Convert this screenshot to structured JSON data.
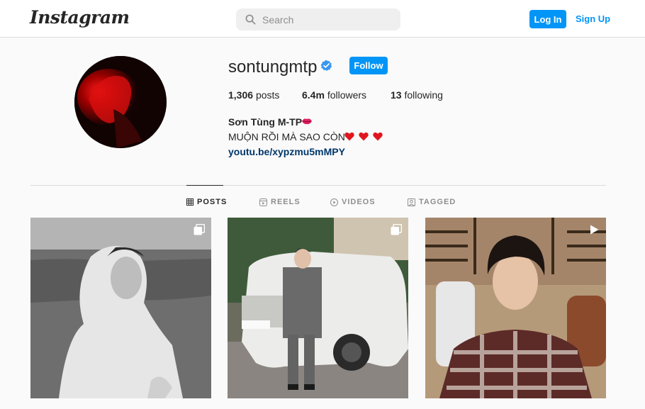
{
  "header": {
    "logo_text": "Instagram",
    "search_placeholder": "Search",
    "login_label": "Log In",
    "signup_label": "Sign Up"
  },
  "profile": {
    "username": "sontungmtp",
    "follow_label": "Follow",
    "posts_count": "1,306",
    "posts_label": "posts",
    "followers_count": "6.4m",
    "followers_label": "followers",
    "following_count": "13",
    "following_label": "following",
    "full_name": "Sơn Tùng M-TP",
    "bio": "MUỘN RỒI MÀ SAO CÒN",
    "link": "youtu.be/xypzmu5mMPY",
    "accent_color": "#0095f6"
  },
  "tabs": [
    {
      "label": "POSTS",
      "icon": "grid-icon",
      "active": true
    },
    {
      "label": "REELS",
      "icon": "reels-icon",
      "active": false
    },
    {
      "label": "VIDEOS",
      "icon": "video-icon",
      "active": false
    },
    {
      "label": "TAGGED",
      "icon": "tagged-icon",
      "active": false
    }
  ],
  "posts": [
    {
      "type": "carousel",
      "badge_icon": "carousel-icon"
    },
    {
      "type": "carousel",
      "badge_icon": "carousel-icon"
    },
    {
      "type": "video",
      "badge_icon": "play-icon"
    }
  ]
}
